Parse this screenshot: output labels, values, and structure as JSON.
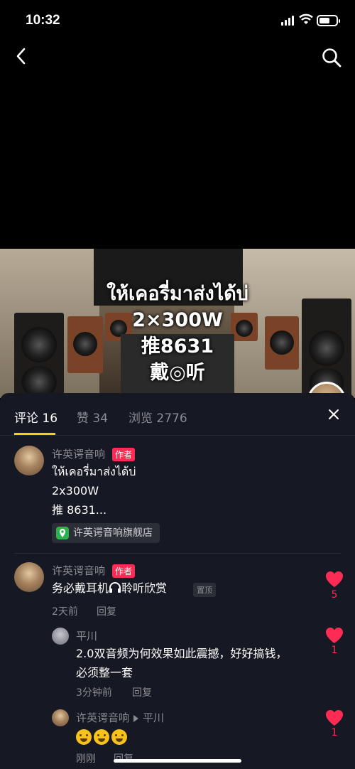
{
  "status_bar": {
    "time": "10:32"
  },
  "video": {
    "caption_lines": [
      "ให้เคอรี่มาส่งได้บ่",
      "2×300W",
      "推8631",
      "戴◎听"
    ]
  },
  "comments_panel": {
    "tabs": [
      {
        "label": "评论 16"
      },
      {
        "label": "赞 34"
      },
      {
        "label": "浏览 2776"
      }
    ],
    "post": {
      "author": "许英谔音响",
      "author_tag": "作者",
      "lines": [
        "ให้เคอรี่มาส่งได้บ่",
        "2x300W",
        "推 8631..."
      ],
      "shop_link": "许英谔音响旗舰店"
    },
    "comments": [
      {
        "author": "许英谔音响",
        "author_tag": "作者",
        "text_before": "务必戴耳机",
        "text_after": "聆听欣赏",
        "pin_label": "置顶",
        "time": "2天前",
        "reply_label": "回复",
        "likes": "5"
      },
      {
        "author": "平川",
        "text_lines": [
          "2.0双音频为何效果如此震撼，好好搞钱，",
          "必须整一套"
        ],
        "time": "3分钟前",
        "reply_label": "回复",
        "likes": "1"
      },
      {
        "author": "许英谔音响",
        "reply_to": "平川",
        "time": "刚刚",
        "reply_label": "回复",
        "likes": "1"
      }
    ]
  },
  "colors": {
    "accent": "#fe2c55",
    "tab_underline": "#face15",
    "sheet_bg": "#161823",
    "muted_text": "#8a8b91"
  }
}
